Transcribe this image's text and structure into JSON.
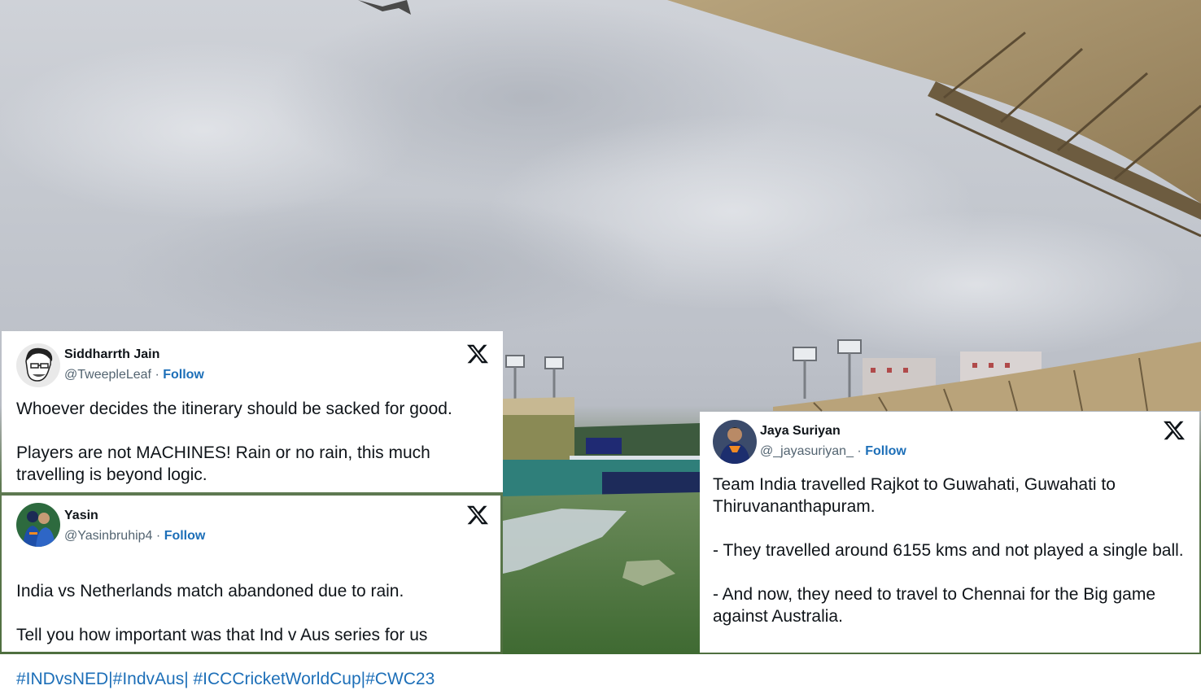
{
  "tweets": [
    {
      "name": "Siddharrth Jain",
      "handle": "@TweepleLeaf",
      "separator": "·",
      "follow": "Follow",
      "text": "Whoever decides the itinerary should be sacked for good.\n\nPlayers are not MACHINES! Rain or no rain, this much travelling is beyond logic.",
      "hashtags": "",
      "icon": "x-logo-icon"
    },
    {
      "name": "Yasin",
      "handle": "@Yasinbruhip4",
      "separator": "·",
      "follow": "Follow",
      "text": "India vs Netherlands match abandoned due to rain.\n\nTell you how important was that Ind v Aus series for us",
      "hashtags": "#INDvsNED|#IndvAus| #ICCCricketWorldCup|#CWC23",
      "icon": "x-logo-icon"
    },
    {
      "name": "Jaya Suriyan",
      "handle": "@_jayasuriyan_",
      "separator": "·",
      "follow": "Follow",
      "text": "Team India travelled Rajkot to Guwahati, Guwahati to Thiruvananthapuram.\n\n- They travelled around 6155 kms and not played a single ball.\n\n- And now, they need to travel to Chennai for the Big game against Australia.",
      "hashtags": "",
      "icon": "x-logo-icon"
    }
  ],
  "colors": {
    "link": "#1d6fb8",
    "text": "#0f1419",
    "muted": "#536471",
    "card_bg": "#ffffff"
  }
}
